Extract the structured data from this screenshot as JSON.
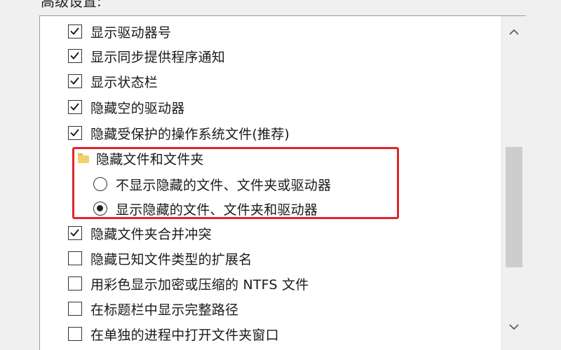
{
  "group_label": "高级设置:",
  "items": [
    {
      "type": "checkbox",
      "checked": true,
      "label": "显示驱动器号"
    },
    {
      "type": "checkbox",
      "checked": true,
      "label": "显示同步提供程序通知"
    },
    {
      "type": "checkbox",
      "checked": true,
      "label": "显示状态栏"
    },
    {
      "type": "checkbox",
      "checked": true,
      "label": "隐藏空的驱动器"
    },
    {
      "type": "checkbox",
      "checked": true,
      "label": "隐藏受保护的操作系统文件(推荐)"
    },
    {
      "type": "folder",
      "label": "隐藏文件和文件夹"
    },
    {
      "type": "radio",
      "checked": false,
      "label": "不显示隐藏的文件、文件夹或驱动器"
    },
    {
      "type": "radio",
      "checked": true,
      "label": "显示隐藏的文件、文件夹和驱动器"
    },
    {
      "type": "checkbox",
      "checked": true,
      "label": "隐藏文件夹合并冲突"
    },
    {
      "type": "checkbox",
      "checked": false,
      "label": "隐藏已知文件类型的扩展名"
    },
    {
      "type": "checkbox",
      "checked": false,
      "label": "用彩色显示加密或压缩的 NTFS 文件"
    },
    {
      "type": "checkbox",
      "checked": false,
      "label": "在标题栏中显示完整路径"
    },
    {
      "type": "checkbox",
      "checked": false,
      "label": "在单独的进程中打开文件夹窗口"
    }
  ],
  "colors": {
    "highlight": "#e0262a",
    "folder": "#f4cf6a"
  },
  "icons": {
    "check": "checkmark-icon",
    "folder": "folder-icon",
    "scroll_up": "chevron-up-icon",
    "scroll_down": "chevron-down-icon"
  }
}
